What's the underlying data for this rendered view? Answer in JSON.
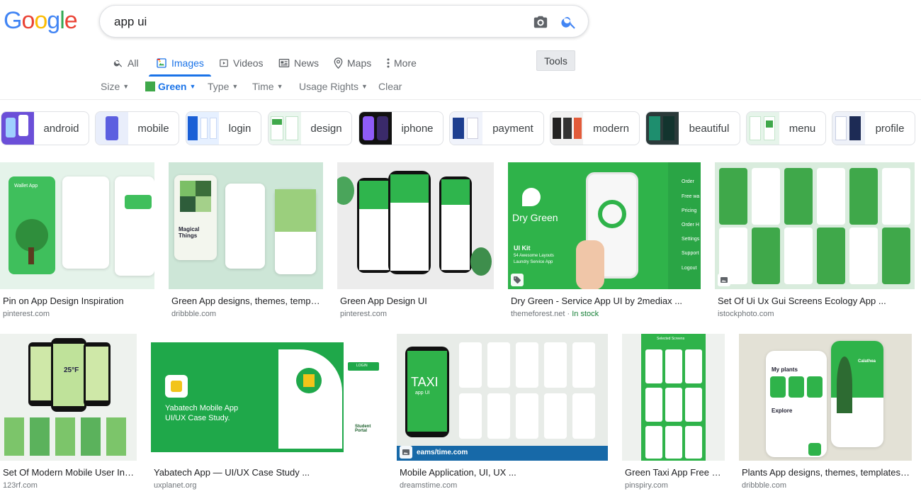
{
  "logo": {
    "letters": [
      "G",
      "o",
      "o",
      "g",
      "l",
      "e"
    ],
    "colors": [
      "#4285f4",
      "#ea4335",
      "#fbbc05",
      "#4285f4",
      "#34a853",
      "#ea4335"
    ]
  },
  "search": {
    "query": "app ui",
    "camera_icon": "camera-icon",
    "search_icon": "search-icon"
  },
  "tabs": [
    {
      "label": "All",
      "icon": "search-icon"
    },
    {
      "label": "Images",
      "icon": "image-icon"
    },
    {
      "label": "Videos",
      "icon": "video-icon"
    },
    {
      "label": "News",
      "icon": "news-icon"
    },
    {
      "label": "Maps",
      "icon": "map-pin-icon"
    },
    {
      "label": "More",
      "icon": "more-vert-icon"
    }
  ],
  "active_tab": "Images",
  "tools_label": "Tools",
  "filters": [
    {
      "label": "Size"
    },
    {
      "label": "Green"
    },
    {
      "label": "Type"
    },
    {
      "label": "Time"
    },
    {
      "label": "Usage Rights"
    },
    {
      "label": "Clear"
    }
  ],
  "chips": [
    "android",
    "mobile",
    "login",
    "design",
    "iphone",
    "payment",
    "modern",
    "beautiful",
    "menu",
    "profile"
  ],
  "results_row1": [
    {
      "title": "Pin on App Design Inspiration",
      "source": "pinterest.com",
      "text": "Wallet App"
    },
    {
      "title": "Green App designs, themes, templat...",
      "source": "dribbble.com",
      "text": "Magical Things"
    },
    {
      "title": "Green App Design UI",
      "source": "pinterest.com",
      "text": ""
    },
    {
      "title": "Dry Green - Service App UI by 2mediax ...",
      "source": "themeforest.net",
      "stock": "In stock",
      "text": "Dry Green",
      "kit": "UI Kit",
      "kit_sub": "54 Awesome Layouts",
      "kit_sub2": "Laundry Service App",
      "menu": [
        "Order",
        "Free wa",
        "Pricing",
        "Order H",
        "Settings",
        "Support",
        "Logout"
      ]
    },
    {
      "title": "Set Of Ui Ux Gui Screens Ecology App ...",
      "source": "istockphoto.com",
      "text": ""
    }
  ],
  "results_row2": [
    {
      "title": "Set Of Modern Mobile User Inter...",
      "source": "123rf.com",
      "text": "25°F"
    },
    {
      "title": "Yabatech App — UI/UX Case Study ...",
      "source": "uxplanet.org",
      "text": "Yabatech Mobile App UI/UX Case Study.",
      "portal": "Student Portal",
      "login": "LOGIN"
    },
    {
      "title": "Mobile Application, UI, UX ...",
      "source": "dreamstime.com",
      "text": "TAXI",
      "sub": "app UI",
      "watermark": "eams/time.com"
    },
    {
      "title": "Green Taxi App Free UI ...",
      "source": "pinspiry.com",
      "text": "Selected Screens"
    },
    {
      "title": "Plants App designs, themes, templates ...",
      "source": "dribbble.com",
      "text": "My plants",
      "sub": "Explore",
      "name": "Calathea"
    }
  ]
}
